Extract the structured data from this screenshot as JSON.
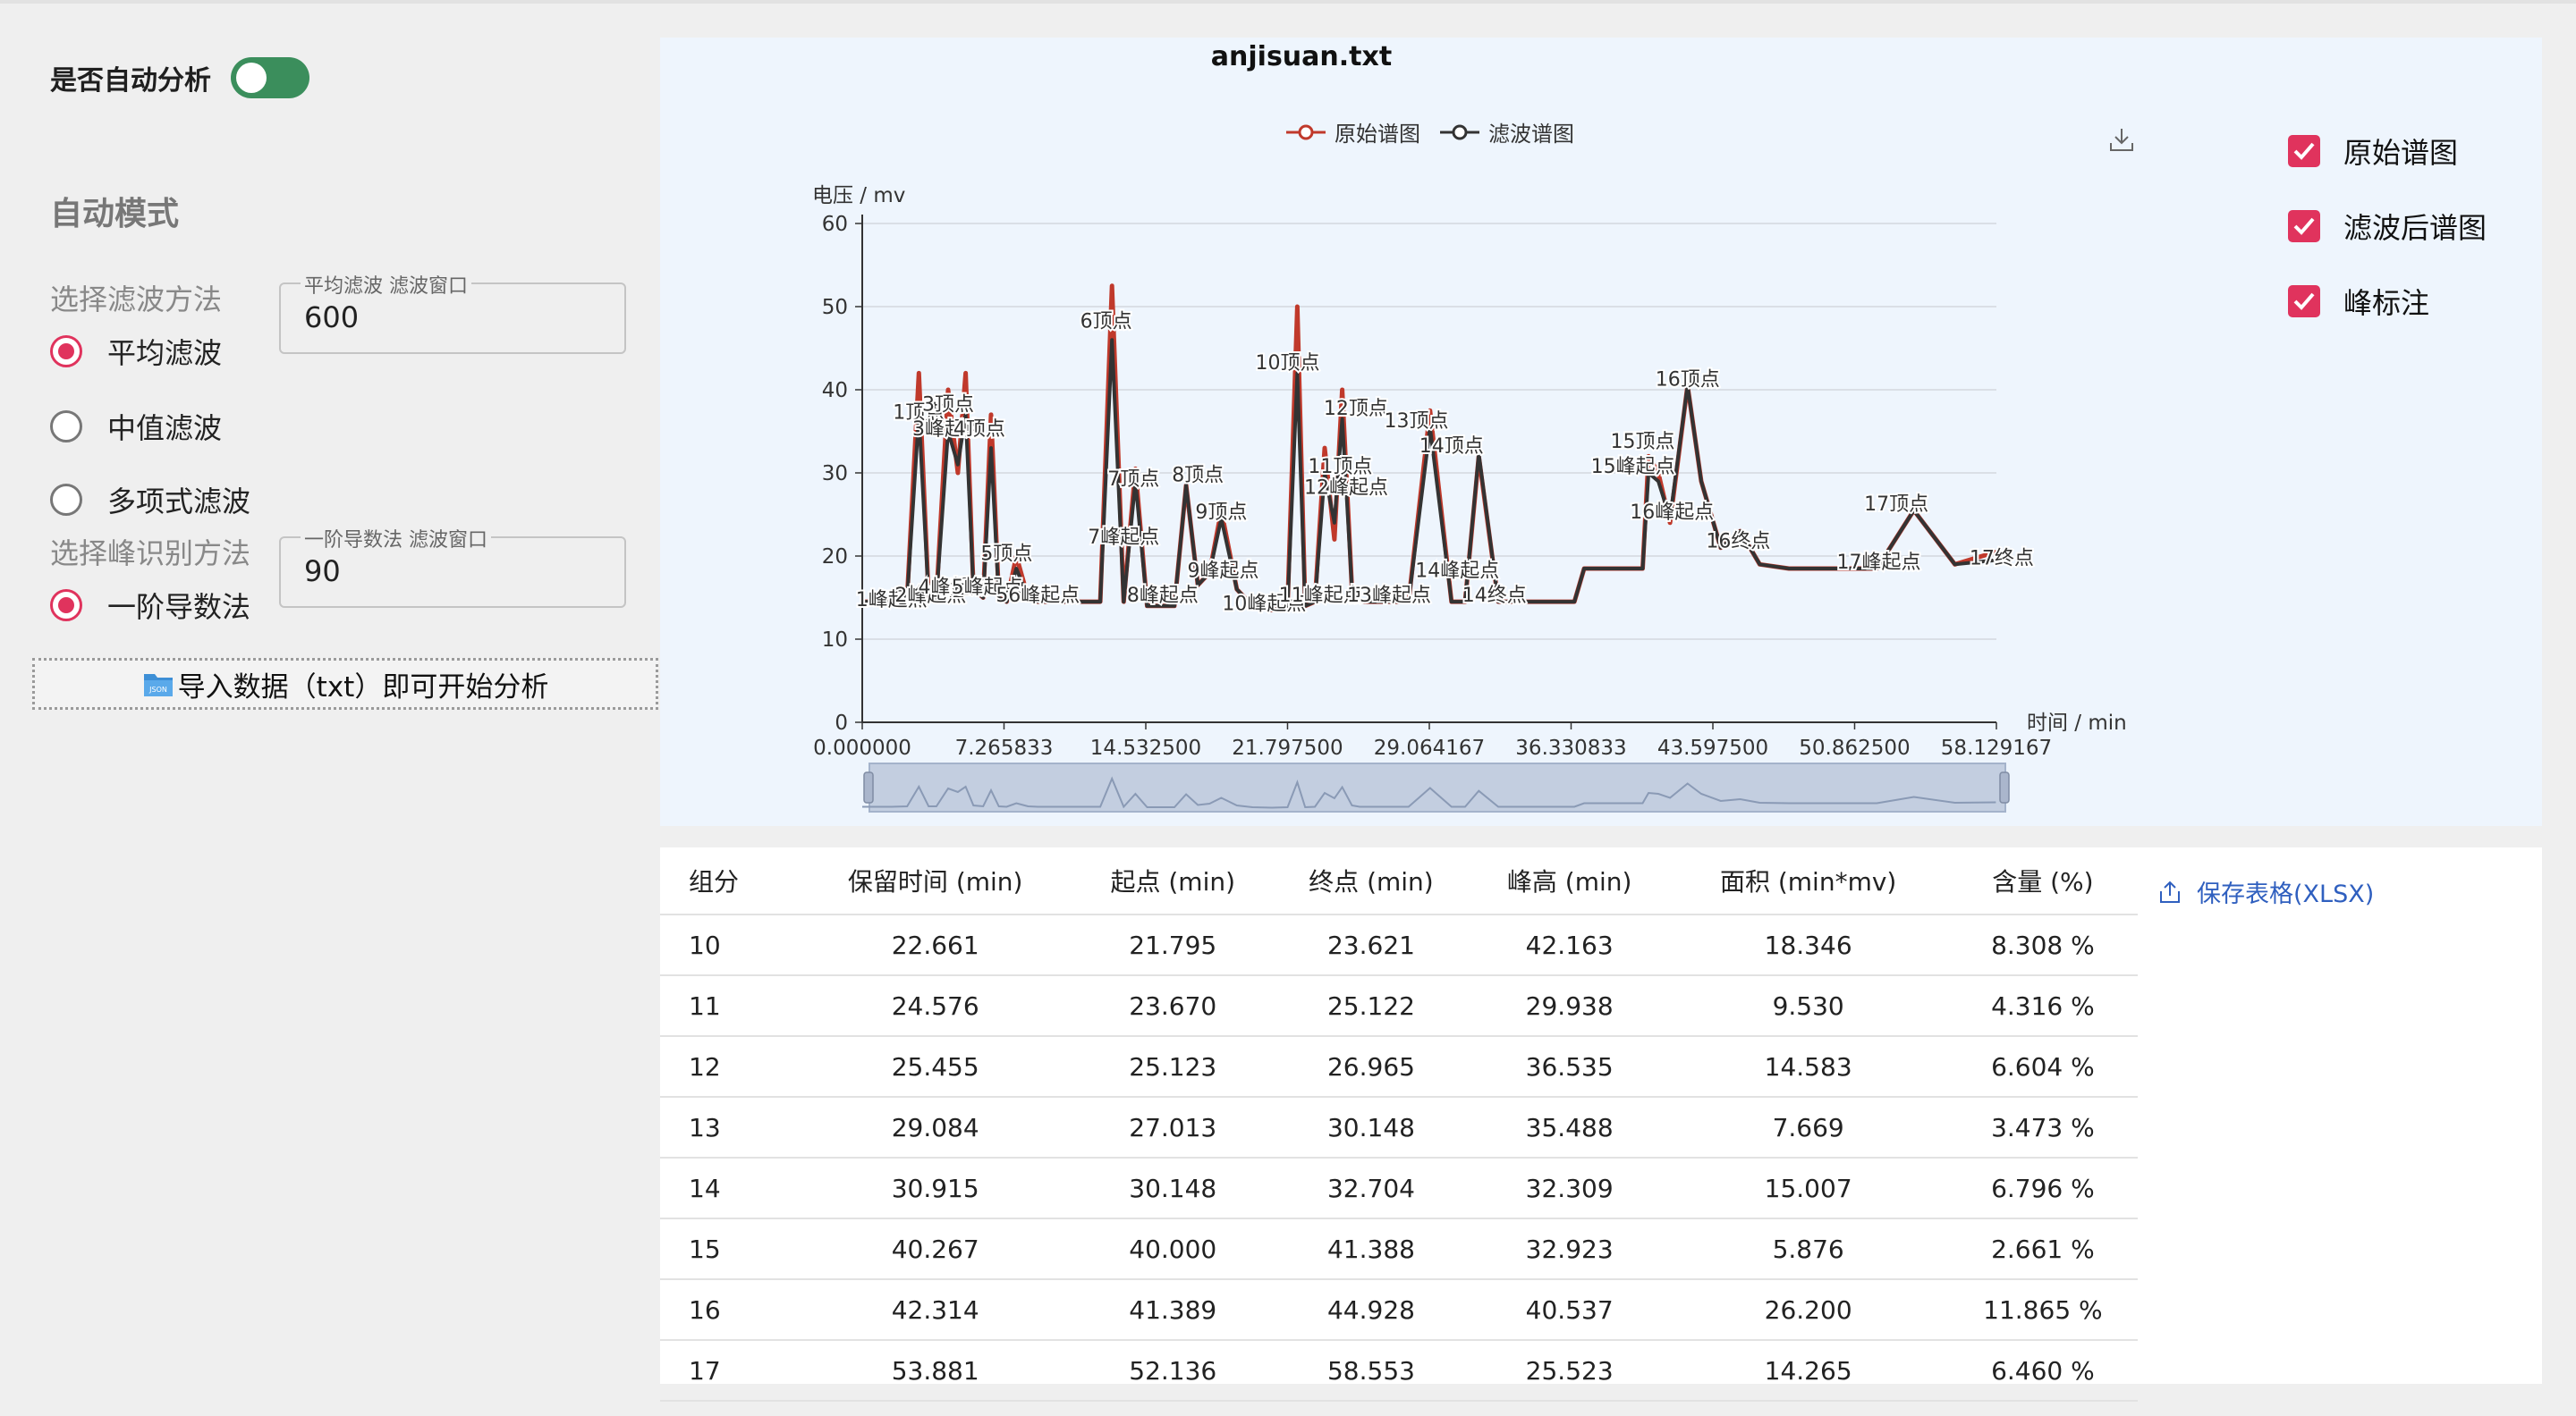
{
  "sidebar": {
    "auto_label": "是否自动分析",
    "mode_title": "自动模式",
    "filter_section": "选择滤波方法",
    "filter_options": [
      "平均滤波",
      "中值滤波",
      "多项式滤波"
    ],
    "filter_selected": "平均滤波",
    "filter_window_label": "平均滤波 滤波窗口",
    "filter_window_value": "600",
    "peak_section": "选择峰识别方法",
    "peak_options": [
      "一阶导数法"
    ],
    "peak_selected": "一阶导数法",
    "peak_window_label": "一阶导数法 滤波窗口",
    "peak_window_value": "90",
    "import_label": "导入数据（txt）即可开始分析",
    "import_icon": "json-folder-icon"
  },
  "chart_options": {
    "items": [
      "原始谱图",
      "滤波后谱图",
      "峰标注"
    ],
    "checked": [
      true,
      true,
      true
    ],
    "accent": "#e0335d"
  },
  "chart_data": {
    "type": "line",
    "title": "anjisuan.txt",
    "ylabel": "电压 / mv",
    "xlabel": "时间 / min",
    "ylim": [
      0,
      60
    ],
    "yticks": [
      "0",
      "10",
      "20",
      "30",
      "40",
      "50",
      "60"
    ],
    "xlim": [
      0,
      58.129167
    ],
    "xticks": [
      "0.000000",
      "7.265833",
      "14.532500",
      "21.797500",
      "29.064167",
      "36.330833",
      "43.597500",
      "50.862500",
      "58.129167"
    ],
    "legend": [
      "原始谱图",
      "滤波谱图"
    ],
    "colors": {
      "raw": "#c0392b",
      "filtered": "#333333"
    },
    "series": [
      {
        "name": "原始谱图",
        "x": [
          0,
          1.5,
          2.3,
          2.9,
          3.4,
          3.8,
          4.4,
          4.9,
          5.3,
          5.7,
          6.2,
          6.6,
          7.0,
          7.4,
          7.9,
          8.5,
          9.0,
          9.6,
          10.4,
          11.4,
          12.2,
          12.8,
          13.4,
          14.0,
          14.6,
          15.2,
          16.0,
          16.6,
          17.2,
          17.8,
          18.4,
          19.2,
          20.0,
          21.0,
          21.8,
          22.3,
          22.7,
          23.2,
          23.7,
          24.2,
          24.6,
          25.1,
          25.5,
          26.0,
          26.5,
          27.0,
          28.0,
          29.1,
          30.2,
          30.9,
          31.6,
          32.6,
          33.5,
          36.0,
          36.5,
          37.0,
          38.5,
          40.0,
          40.3,
          40.8,
          41.4,
          42.3,
          43.0,
          44.0,
          45.0,
          46.0,
          47.5,
          49.0,
          52.0,
          53.9,
          56.0,
          58.1
        ],
        "y": [
          14.5,
          14.5,
          15.0,
          42.0,
          15.0,
          15.0,
          40.0,
          30.0,
          42.0,
          16.0,
          15.0,
          37.0,
          15.0,
          14.5,
          20.0,
          15.0,
          14.5,
          14.5,
          14.5,
          14.5,
          14.5,
          52.5,
          14.5,
          30.5,
          14.0,
          14.0,
          14.0,
          28.5,
          16.5,
          18.0,
          25.5,
          16.0,
          14.0,
          13.5,
          14.0,
          50.0,
          14.0,
          14.5,
          33.0,
          22.0,
          40.0,
          16.0,
          14.5,
          14.5,
          14.5,
          14.5,
          14.5,
          37.5,
          14.5,
          14.5,
          32.0,
          14.5,
          14.5,
          14.5,
          14.5,
          18.5,
          18.5,
          18.5,
          32.0,
          30.0,
          24.0,
          40.5,
          29.0,
          21.0,
          23.0,
          19.0,
          18.5,
          18.5,
          18.5,
          25.5,
          19.0,
          20.5
        ]
      },
      {
        "name": "滤波谱图",
        "x": [
          0,
          1.5,
          2.3,
          2.9,
          3.4,
          3.8,
          4.4,
          4.9,
          5.3,
          5.7,
          6.2,
          6.6,
          7.0,
          7.4,
          7.9,
          8.5,
          9.0,
          9.6,
          10.4,
          11.4,
          12.2,
          12.8,
          13.4,
          14.0,
          14.6,
          15.2,
          16.0,
          16.6,
          17.2,
          17.8,
          18.4,
          19.2,
          20.0,
          21.0,
          21.8,
          22.3,
          22.7,
          23.2,
          23.7,
          24.2,
          24.6,
          25.1,
          25.5,
          26.0,
          26.5,
          27.0,
          28.0,
          29.1,
          30.2,
          30.9,
          31.6,
          32.6,
          33.5,
          36.0,
          36.5,
          37.0,
          38.5,
          40.0,
          40.3,
          40.8,
          41.4,
          42.3,
          43.0,
          44.0,
          45.0,
          46.0,
          47.5,
          49.0,
          52.0,
          53.9,
          56.0,
          58.1
        ],
        "y": [
          14.5,
          14.5,
          15.0,
          37.0,
          15.0,
          15.0,
          35.0,
          31.0,
          37.0,
          16.0,
          15.0,
          33.0,
          15.0,
          14.5,
          18.5,
          15.0,
          14.5,
          14.5,
          14.5,
          14.5,
          14.5,
          46.0,
          14.5,
          29.0,
          14.0,
          14.0,
          14.0,
          28.5,
          16.5,
          18.0,
          24.5,
          16.0,
          14.0,
          13.5,
          14.0,
          42.0,
          14.0,
          14.5,
          30.0,
          24.0,
          36.5,
          16.0,
          14.5,
          14.5,
          14.5,
          14.5,
          14.5,
          35.5,
          14.5,
          14.5,
          32.3,
          14.5,
          14.5,
          14.5,
          14.5,
          18.5,
          18.5,
          18.5,
          30.0,
          29.0,
          24.5,
          40.5,
          29.0,
          21.0,
          23.0,
          19.0,
          18.5,
          18.5,
          18.5,
          25.5,
          19.0,
          19.5
        ]
      }
    ],
    "annotations": [
      {
        "text": "1顶点",
        "x": 2.9,
        "y": 36.5
      },
      {
        "text": "1峰起点",
        "x": 1.5,
        "y": 14.0
      },
      {
        "text": "2峰起点",
        "x": 3.5,
        "y": 14.5
      },
      {
        "text": "3顶点",
        "x": 4.4,
        "y": 37.5
      },
      {
        "text": "3峰起点",
        "x": 4.4,
        "y": 34.5
      },
      {
        "text": "4顶点",
        "x": 6.0,
        "y": 34.5
      },
      {
        "text": "4峰起点",
        "x": 4.7,
        "y": 15.5
      },
      {
        "text": "5顶点",
        "x": 7.4,
        "y": 19.5
      },
      {
        "text": "5峰起点",
        "x": 6.4,
        "y": 15.5
      },
      {
        "text": "56峰起点",
        "x": 9.0,
        "y": 14.5
      },
      {
        "text": "6顶点",
        "x": 12.5,
        "y": 47.5
      },
      {
        "text": "7顶点",
        "x": 13.9,
        "y": 28.5
      },
      {
        "text": "7峰起点",
        "x": 13.4,
        "y": 21.5
      },
      {
        "text": "8顶点",
        "x": 17.2,
        "y": 29.0
      },
      {
        "text": "8峰起点",
        "x": 15.4,
        "y": 14.5
      },
      {
        "text": "9顶点",
        "x": 18.4,
        "y": 24.5
      },
      {
        "text": "9峰起点",
        "x": 18.5,
        "y": 17.5
      },
      {
        "text": "10顶点",
        "x": 21.8,
        "y": 42.5
      },
      {
        "text": "10峰起点",
        "x": 20.6,
        "y": 13.5
      },
      {
        "text": "11顶点",
        "x": 24.5,
        "y": 30.0
      },
      {
        "text": "11峰起点",
        "x": 23.5,
        "y": 14.5
      },
      {
        "text": "12顶点",
        "x": 25.3,
        "y": 37.0
      },
      {
        "text": "12峰起点",
        "x": 24.8,
        "y": 27.5
      },
      {
        "text": "13顶点",
        "x": 28.4,
        "y": 35.5
      },
      {
        "text": "13峰起点",
        "x": 27.0,
        "y": 14.5
      },
      {
        "text": "14顶点",
        "x": 30.2,
        "y": 32.5
      },
      {
        "text": "14峰起点",
        "x": 30.5,
        "y": 17.5
      },
      {
        "text": "14终点",
        "x": 32.4,
        "y": 14.5
      },
      {
        "text": "15顶点",
        "x": 40.0,
        "y": 33.0
      },
      {
        "text": "15峰起点",
        "x": 39.5,
        "y": 30.0
      },
      {
        "text": "16顶点",
        "x": 42.3,
        "y": 40.5
      },
      {
        "text": "16峰起点",
        "x": 41.5,
        "y": 24.5
      },
      {
        "text": "16终点",
        "x": 44.9,
        "y": 21.0
      },
      {
        "text": "17顶点",
        "x": 53.0,
        "y": 25.5
      },
      {
        "text": "17峰起点",
        "x": 52.1,
        "y": 18.5
      },
      {
        "text": "17终点",
        "x": 58.4,
        "y": 19.0
      }
    ],
    "grid": true,
    "legend_position": "top-center",
    "datazoom": true
  },
  "download_icon": "download-icon",
  "table": {
    "headers": [
      "组分",
      "保留时间 (min)",
      "起点 (min)",
      "终点 (min)",
      "峰高 (min)",
      "面积 (min*mv)",
      "含量 (%)"
    ],
    "rows": [
      [
        "10",
        "22.661",
        "21.795",
        "23.621",
        "42.163",
        "18.346",
        "8.308 %"
      ],
      [
        "11",
        "24.576",
        "23.670",
        "25.122",
        "29.938",
        "9.530",
        "4.316 %"
      ],
      [
        "12",
        "25.455",
        "25.123",
        "26.965",
        "36.535",
        "14.583",
        "6.604 %"
      ],
      [
        "13",
        "29.084",
        "27.013",
        "30.148",
        "35.488",
        "7.669",
        "3.473 %"
      ],
      [
        "14",
        "30.915",
        "30.148",
        "32.704",
        "32.309",
        "15.007",
        "6.796 %"
      ],
      [
        "15",
        "40.267",
        "40.000",
        "41.388",
        "32.923",
        "5.876",
        "2.661 %"
      ],
      [
        "16",
        "42.314",
        "41.389",
        "44.928",
        "40.537",
        "26.200",
        "11.865 %"
      ],
      [
        "17",
        "53.881",
        "52.136",
        "58.553",
        "25.523",
        "14.265",
        "6.460 %"
      ]
    ],
    "save_label": "保存表格(XLSX)",
    "save_icon": "export-icon"
  }
}
